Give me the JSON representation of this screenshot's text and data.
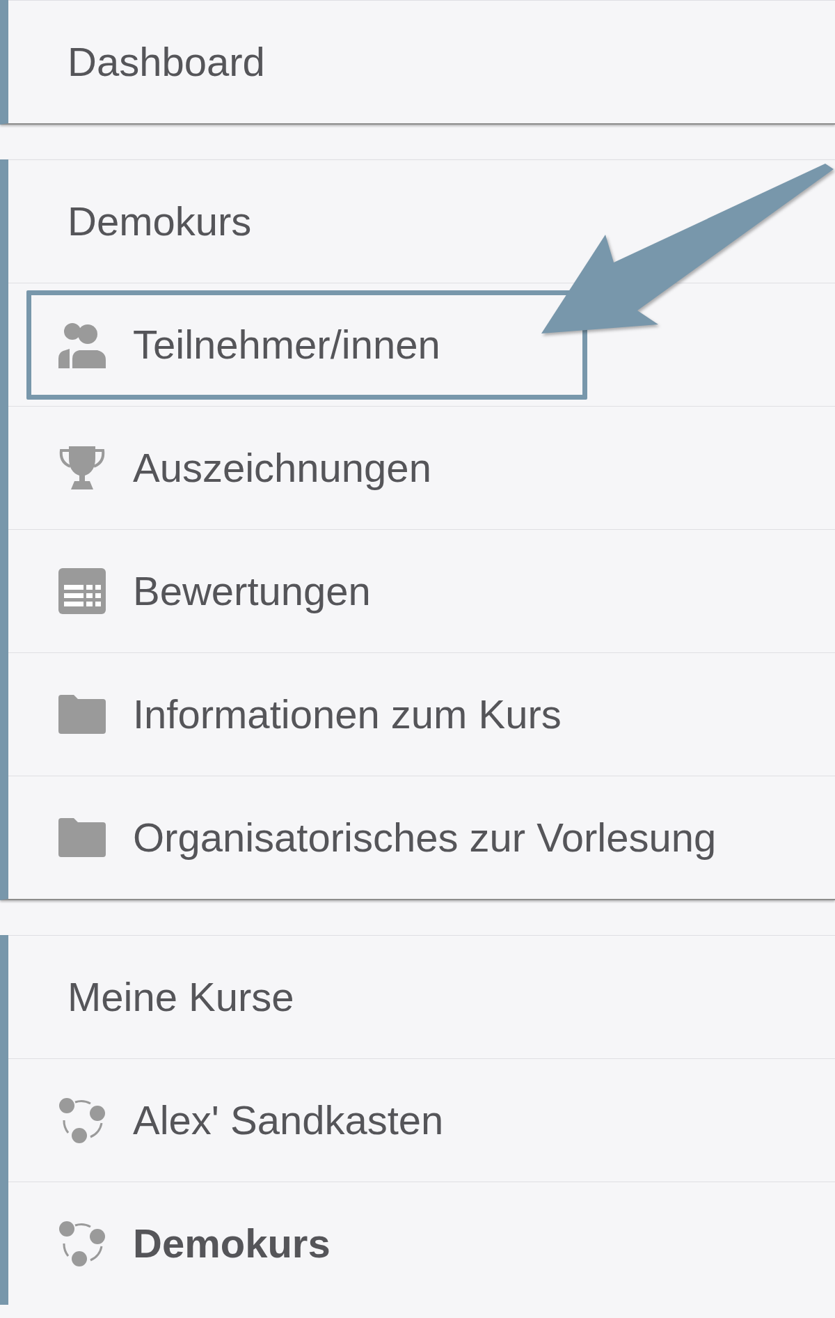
{
  "sidebar": {
    "blocks": [
      {
        "header": "Dashboard"
      },
      {
        "header": "Demokurs",
        "items": [
          {
            "label": "Teilnehmer/innen",
            "kind": "participants",
            "highlighted": true
          },
          {
            "label": "Auszeichnungen",
            "kind": "badges",
            "highlighted": false
          },
          {
            "label": "Bewertungen",
            "kind": "grades",
            "highlighted": false
          },
          {
            "label": "Informationen zum Kurs",
            "kind": "folder",
            "highlighted": false
          },
          {
            "label": "Organisatorisches zur Vorlesung",
            "kind": "folder",
            "highlighted": false
          }
        ]
      },
      {
        "header": "Meine Kurse",
        "items": [
          {
            "label": "Alex' Sandkasten",
            "kind": "course",
            "selected": false
          },
          {
            "label": "Demokurs",
            "kind": "course",
            "selected": true
          }
        ]
      }
    ]
  }
}
